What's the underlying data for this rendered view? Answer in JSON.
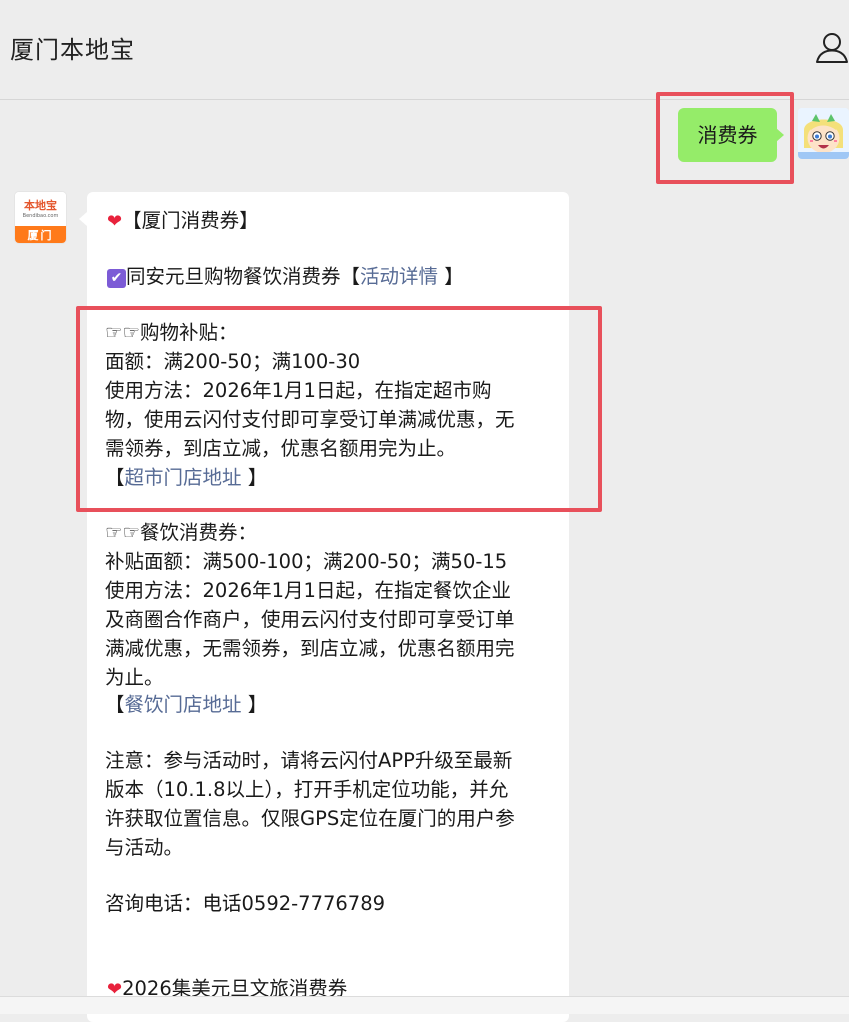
{
  "header": {
    "title": "厦门本地宝"
  },
  "sent_message": {
    "text": "消费券"
  },
  "bot": {
    "avatar_logo": "本地宝",
    "avatar_logo_sub": "Bendibao.com",
    "avatar_city": "厦门"
  },
  "message": {
    "heart_icon": "❤",
    "section1_title": "【厦门消费券】",
    "check_icon": "✔",
    "event_line_prefix": "同安元旦购物餐饮消费券【",
    "event_link": "活动详情",
    "event_line_suffix": " 】",
    "shopping_title": "☞☞购物补贴：",
    "shopping_amount": "面额：满200-50；满100-30",
    "shopping_usage_1": "使用方法：2026年1月1日起，在指定超市购",
    "shopping_usage_2": "物，使用云闪付支付即可享受订单满减优惠，无",
    "shopping_usage_3": "需领券，到店立减，优惠名额用完为止。",
    "shopping_addr_prefix": "【",
    "shopping_addr_link": "超市门店地址",
    "shopping_addr_suffix": " 】",
    "dining_title": "☞☞餐饮消费券：",
    "dining_amount": "补贴面额：满500-100；满200-50；满50-15",
    "dining_usage_1": "使用方法：2026年1月1日起，在指定餐饮企业",
    "dining_usage_2": "及商圈合作商户，使用云闪付支付即可享受订单",
    "dining_usage_3": "满减优惠，无需领券，到店立减，优惠名额用完",
    "dining_usage_4": "为止。",
    "dining_addr_prefix": "【",
    "dining_addr_link": "餐饮门店地址",
    "dining_addr_suffix": " 】",
    "note_1": "注意：参与活动时，请将云闪付APP升级至最新",
    "note_2": "版本（10.1.8以上），打开手机定位功能，并允",
    "note_3": "许获取位置信息。仅限GPS定位在厦门的用户参",
    "note_4": "与活动。",
    "phone": "咨询电话：电话0592-7776789",
    "section2_title": "2026集美元旦文旅消费券"
  },
  "colors": {
    "sent_bubble": "#95ec69",
    "link": "#576b95",
    "highlight_border": "#e8505b",
    "heart": "#e8223c",
    "checkbox": "#7c5bd6",
    "avatar_orange": "#ff7a1a"
  }
}
